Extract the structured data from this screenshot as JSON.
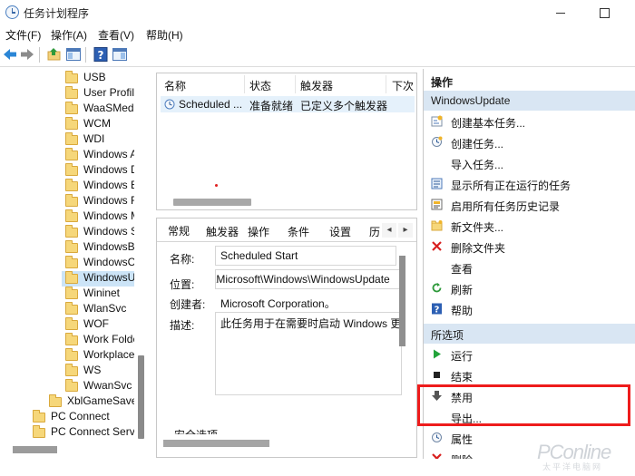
{
  "window": {
    "title": "任务计划程序"
  },
  "menu": {
    "items": [
      "文件(F)",
      "操作(A)",
      "查看(V)",
      "帮助(H)"
    ]
  },
  "toolbar": {
    "icons": [
      "back-arrow-icon",
      "forward-arrow-icon",
      "folder-up-icon",
      "show-hide-tree-icon",
      "help-icon",
      "action-pane-icon"
    ]
  },
  "tree": {
    "items": [
      {
        "label": "USB",
        "level": 2
      },
      {
        "label": "User Profile",
        "level": 2
      },
      {
        "label": "WaaSMedi",
        "level": 2
      },
      {
        "label": "WCM",
        "level": 2
      },
      {
        "label": "WDI",
        "level": 2
      },
      {
        "label": "Windows A",
        "level": 2
      },
      {
        "label": "Windows D",
        "level": 2
      },
      {
        "label": "Windows E",
        "level": 2
      },
      {
        "label": "Windows F",
        "level": 2
      },
      {
        "label": "Windows M",
        "level": 2
      },
      {
        "label": "Windows S",
        "level": 2
      },
      {
        "label": "WindowsBa",
        "level": 2
      },
      {
        "label": "WindowsCo",
        "level": 2
      },
      {
        "label": "WindowsU",
        "level": 2,
        "selected": true
      },
      {
        "label": "Wininet",
        "level": 2
      },
      {
        "label": "WlanSvc",
        "level": 2
      },
      {
        "label": "WOF",
        "level": 2
      },
      {
        "label": "Work Folde",
        "level": 2
      },
      {
        "label": "Workplace",
        "level": 2
      },
      {
        "label": "WS",
        "level": 2
      },
      {
        "label": "WwanSvc",
        "level": 2
      },
      {
        "label": "XblGameSave",
        "level": 1
      },
      {
        "label": "PC Connect",
        "level": 0
      },
      {
        "label": "PC Connect Servic",
        "level": 0
      }
    ]
  },
  "task_list": {
    "columns": [
      "名称",
      "状态",
      "触发器",
      "下次"
    ],
    "rows": [
      {
        "name": "Scheduled ...",
        "status": "准备就绪",
        "trigger": "已定义多个触发器"
      }
    ]
  },
  "detail": {
    "tabs": [
      "常规",
      "触发器",
      "操作",
      "条件",
      "设置",
      "历"
    ],
    "fields": {
      "name_label": "名称:",
      "name_value": "Scheduled Start",
      "location_label": "位置:",
      "location_value": "\\Microsoft\\Windows\\WindowsUpdate",
      "author_label": "创建者:",
      "author_value": "Microsoft Corporation。",
      "desc_label": "描述:",
      "desc_value": "此任务用于在需要时启动 Windows 更新"
    },
    "security_label": "安全选项"
  },
  "actions": {
    "header": "操作",
    "section1_title": "WindowsUpdate",
    "section1_items": [
      {
        "label": "创建基本任务...",
        "icon": "create-basic-task-icon"
      },
      {
        "label": "创建任务...",
        "icon": "create-task-icon"
      },
      {
        "label": "导入任务...",
        "icon": ""
      },
      {
        "label": "显示所有正在运行的任务",
        "icon": "running-tasks-icon"
      },
      {
        "label": "启用所有任务历史记录",
        "icon": "history-icon"
      },
      {
        "label": "新文件夹...",
        "icon": "new-folder-icon"
      },
      {
        "label": "删除文件夹",
        "icon": "delete-icon"
      },
      {
        "label": "查看",
        "icon": ""
      },
      {
        "label": "刷新",
        "icon": "refresh-icon"
      },
      {
        "label": "帮助",
        "icon": "help-icon"
      }
    ],
    "section2_title": "所选项",
    "section2_items": [
      {
        "label": "运行",
        "icon": "run-icon"
      },
      {
        "label": "结束",
        "icon": "end-icon"
      },
      {
        "label": "禁用",
        "icon": "disable-icon"
      },
      {
        "label": "导出...",
        "icon": ""
      },
      {
        "label": "属性",
        "icon": "properties-icon"
      },
      {
        "label": "删除",
        "icon": "delete-icon"
      }
    ]
  },
  "watermark": {
    "brand": "PConline",
    "sub": "太平洋电脑网"
  },
  "colors": {
    "selection": "#cce4f7",
    "section_header": "#d9e6f3",
    "highlight": "#ee1c1c",
    "accent": "#0a64c8"
  }
}
